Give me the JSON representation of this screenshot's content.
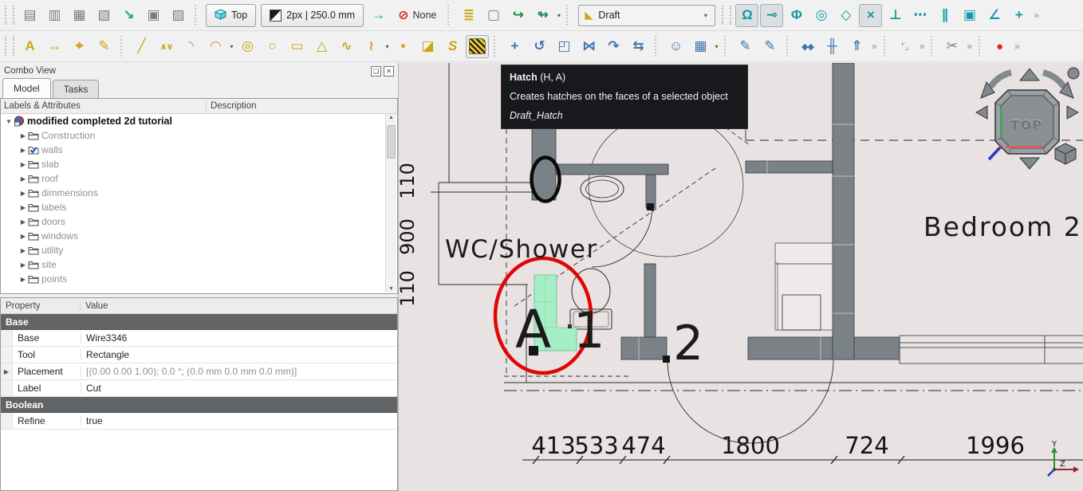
{
  "toolbar_row1": [
    {
      "t": "handle"
    },
    {
      "t": "icon",
      "name": "layers",
      "glyph": "▤",
      "tone": "gray"
    },
    {
      "t": "icon",
      "name": "layer-manager",
      "glyph": "▥",
      "tone": "gray"
    },
    {
      "t": "icon",
      "name": "add-to-layer",
      "glyph": "▦",
      "tone": "gray"
    },
    {
      "t": "icon",
      "name": "select-layer-contents",
      "glyph": "▧",
      "tone": "gray"
    },
    {
      "t": "icon",
      "name": "add-to-construction-group",
      "glyph": "↘",
      "tone": "teal"
    },
    {
      "t": "icon",
      "name": "add-to-group",
      "glyph": "▣",
      "tone": "gray"
    },
    {
      "t": "icon",
      "name": "working-plane-proxy",
      "glyph": "▨",
      "tone": "gray"
    },
    {
      "t": "sep"
    },
    {
      "t": "btn",
      "name": "view-top-button",
      "label": "Top",
      "icon": "cube"
    },
    {
      "t": "btn",
      "name": "line-style-button",
      "label": "2px | 250.0 mm",
      "icon": "halfsquare"
    },
    {
      "t": "icon",
      "name": "apply-current-style",
      "glyph": "→",
      "tone": "teal"
    },
    {
      "t": "flatbtn",
      "name": "autogroup-button",
      "label": "None",
      "glyph": "⊘"
    },
    {
      "t": "sep"
    },
    {
      "t": "icon",
      "name": "arch-component",
      "glyph": "≣",
      "tone": "yellow"
    },
    {
      "t": "icon",
      "name": "group-folder",
      "glyph": "▢",
      "tone": "gray"
    },
    {
      "t": "icon",
      "name": "import-link",
      "glyph": "↪",
      "tone": "green"
    },
    {
      "t": "icon",
      "name": "export-link",
      "glyph": "↬",
      "tone": "green",
      "caret": true
    },
    {
      "t": "sep"
    },
    {
      "t": "wbcombo",
      "name": "workbench-selector",
      "label": "Draft"
    },
    {
      "t": "handle"
    },
    {
      "t": "icon",
      "name": "snap-lock",
      "glyph": "Ω",
      "tone": "teal",
      "pressed": true
    },
    {
      "t": "icon",
      "name": "snap-endpoint",
      "glyph": "⊸",
      "tone": "teal",
      "pressed": true
    },
    {
      "t": "icon",
      "name": "snap-midpoint",
      "glyph": "Φ",
      "tone": "teal"
    },
    {
      "t": "icon",
      "name": "snap-center",
      "glyph": "◎",
      "tone": "teal"
    },
    {
      "t": "icon",
      "name": "snap-special",
      "glyph": "◇",
      "tone": "teal"
    },
    {
      "t": "icon",
      "name": "snap-intersection",
      "glyph": "×",
      "tone": "teal",
      "pressed": true
    },
    {
      "t": "icon",
      "name": "snap-perpendicular",
      "glyph": "⊥",
      "tone": "teal"
    },
    {
      "t": "icon",
      "name": "snap-extension",
      "glyph": "⋯",
      "tone": "teal"
    },
    {
      "t": "icon",
      "name": "snap-parallel",
      "glyph": "∥",
      "tone": "teal"
    },
    {
      "t": "icon",
      "name": "snap-working-plane",
      "glyph": "▣",
      "tone": "teal"
    },
    {
      "t": "icon",
      "name": "snap-angle",
      "glyph": "∠",
      "tone": "teal"
    },
    {
      "t": "icon",
      "name": "snap-grid",
      "glyph": "+",
      "tone": "teal"
    },
    {
      "t": "overflow",
      "label": "»"
    }
  ],
  "toolbar_row2": [
    {
      "t": "handle"
    },
    {
      "t": "icon",
      "name": "draft-text",
      "glyph": "A",
      "tone": "yellow"
    },
    {
      "t": "icon",
      "name": "draft-dimension",
      "glyph": "↔",
      "tone": "yellow"
    },
    {
      "t": "icon",
      "name": "draft-label",
      "glyph": "⌖",
      "tone": "yellow"
    },
    {
      "t": "icon",
      "name": "annotation-style-editor",
      "glyph": "✎",
      "tone": "yellow"
    },
    {
      "t": "sep"
    },
    {
      "t": "icon",
      "name": "draft-line",
      "glyph": "╱",
      "tone": "yellow"
    },
    {
      "t": "icon",
      "name": "draft-polyline",
      "glyph": "∧∨",
      "tone": "yellow",
      "multi": true
    },
    {
      "t": "icon",
      "name": "draft-fillet",
      "glyph": "◝",
      "tone": "yellow"
    },
    {
      "t": "icon",
      "name": "draft-arc",
      "glyph": "◠",
      "tone": "yellow",
      "caret": true
    },
    {
      "t": "icon",
      "name": "draft-circle",
      "glyph": "◎",
      "tone": "yellow"
    },
    {
      "t": "icon",
      "name": "draft-ellipse",
      "glyph": "○",
      "tone": "yellow"
    },
    {
      "t": "icon",
      "name": "draft-rectangle",
      "glyph": "▭",
      "tone": "yellow"
    },
    {
      "t": "icon",
      "name": "draft-polygon",
      "glyph": "△",
      "tone": "yellow"
    },
    {
      "t": "icon",
      "name": "draft-bspline",
      "glyph": "∿",
      "tone": "yellow"
    },
    {
      "t": "icon",
      "name": "draft-bezier",
      "glyph": "≀",
      "tone": "yellow",
      "caret": true
    },
    {
      "t": "icon",
      "name": "draft-point",
      "glyph": "•",
      "tone": "yellow"
    },
    {
      "t": "icon",
      "name": "draft-facebinder",
      "glyph": "◪",
      "tone": "yellow"
    },
    {
      "t": "icon",
      "name": "draft-shapestring",
      "glyph": "S",
      "tone": "yellow",
      "italic": true
    },
    {
      "t": "hatch",
      "name": "draft-hatch"
    },
    {
      "t": "sep"
    },
    {
      "t": "icon",
      "name": "draft-move",
      "glyph": "+",
      "tone": "blue"
    },
    {
      "t": "icon",
      "name": "draft-rotate",
      "glyph": "↺",
      "tone": "blue"
    },
    {
      "t": "icon",
      "name": "draft-scale",
      "glyph": "◰",
      "tone": "blue"
    },
    {
      "t": "icon",
      "name": "draft-mirror",
      "glyph": "⋈",
      "tone": "blue"
    },
    {
      "t": "icon",
      "name": "draft-offset",
      "glyph": "↷",
      "tone": "blue"
    },
    {
      "t": "icon",
      "name": "draft-trimex",
      "glyph": "⇆",
      "tone": "blue"
    },
    {
      "t": "sep"
    },
    {
      "t": "icon",
      "name": "draft-clone",
      "glyph": "☺",
      "tone": "blue"
    },
    {
      "t": "icon",
      "name": "draft-array",
      "glyph": "▦",
      "tone": "blue",
      "caret": true
    },
    {
      "t": "sep"
    },
    {
      "t": "icon",
      "name": "draft-to-sketch",
      "glyph": "✎",
      "tone": "blue"
    },
    {
      "t": "icon",
      "name": "draft-subelement-edit",
      "glyph": "✎",
      "tone": "blue"
    },
    {
      "t": "sep"
    },
    {
      "t": "icon",
      "name": "draft-join",
      "glyph": "◆◆",
      "tone": "blue",
      "multi": true
    },
    {
      "t": "icon",
      "name": "draft-split",
      "glyph": "╫",
      "tone": "blue"
    },
    {
      "t": "icon",
      "name": "draft-upgrade",
      "glyph": "⇑",
      "tone": "blue"
    },
    {
      "t": "overflow",
      "label": "»"
    },
    {
      "t": "sep"
    },
    {
      "t": "icon",
      "name": "box-element-selection",
      "glyph": "⌜⌟",
      "tone": "gray",
      "multi": true
    },
    {
      "t": "overflow",
      "label": "»"
    },
    {
      "t": "sep"
    },
    {
      "t": "icon",
      "name": "cut-scissors",
      "glyph": "✂",
      "tone": "gray"
    },
    {
      "t": "overflow",
      "label": "»"
    },
    {
      "t": "sep"
    },
    {
      "t": "icon",
      "name": "macro-record",
      "glyph": "●",
      "tone": "red"
    },
    {
      "t": "overflow",
      "label": "»"
    }
  ],
  "combo_view": {
    "title": "Combo View",
    "tabs": [
      "Model",
      "Tasks"
    ],
    "active_tab": "Model",
    "tree_header": {
      "col1": "Labels & Attributes",
      "col2": "Description"
    },
    "tree_root": "modified completed 2d tutorial",
    "tree_items": [
      {
        "label": "Construction"
      },
      {
        "label": "walls",
        "edited": true
      },
      {
        "label": "slab"
      },
      {
        "label": "roof"
      },
      {
        "label": "dimmensions"
      },
      {
        "label": "labels"
      },
      {
        "label": "doors"
      },
      {
        "label": "windows"
      },
      {
        "label": "utility"
      },
      {
        "label": "site"
      },
      {
        "label": "points"
      }
    ],
    "properties": {
      "header": {
        "col1": "Property",
        "col2": "Value"
      },
      "rows": [
        {
          "type": "group",
          "name": "Base"
        },
        {
          "name": "Base",
          "value": "Wire3346"
        },
        {
          "name": "Tool",
          "value": "Rectangle"
        },
        {
          "name": "Placement",
          "value": "[(0.00 0.00 1.00); 0.0 °; (0.0 mm  0.0 mm  0.0 mm)]",
          "expandable": true,
          "dim": true
        },
        {
          "name": "Label",
          "value": "Cut"
        },
        {
          "type": "group",
          "name": "Boolean"
        },
        {
          "name": "Refine",
          "value": "true"
        }
      ]
    }
  },
  "tooltip": {
    "title": "Hatch",
    "shortcut": "(H, A)",
    "description": "Creates hatches on the faces of a selected object",
    "command": "Draft_Hatch"
  },
  "viewport": {
    "wc_label": "WC/Shower",
    "bedroom_label": "Bedroom 2",
    "hatch_letter": "A",
    "door_number_1": "1",
    "door_number_2": "2",
    "h_dims": [
      "413",
      "533",
      "474",
      "1800",
      "724",
      "1996"
    ],
    "v_dims": [
      "110",
      "900",
      "110"
    ],
    "nav_cube_label": "TOP",
    "axis_labels": {
      "y": "Y",
      "z": "Z"
    },
    "colors": {
      "hatch_green": "#a5eec6",
      "annotation_red": "#e10505",
      "wall_gray": "#7b8287",
      "viewport_background": "#e8e3e2",
      "tooltip_background": "#17191c"
    }
  }
}
